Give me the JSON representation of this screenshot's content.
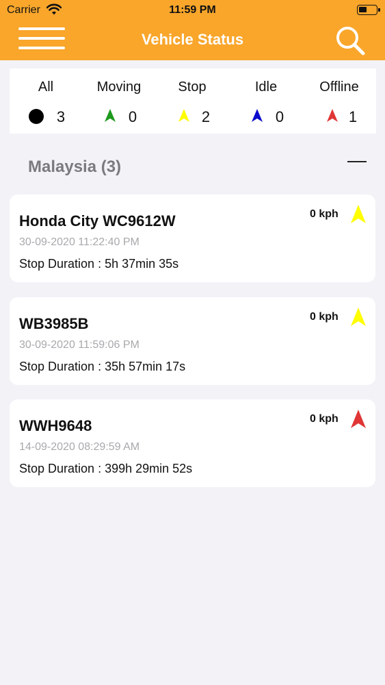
{
  "statusbar": {
    "carrier": "Carrier",
    "time": "11:59 PM"
  },
  "navbar": {
    "title": "Vehicle Status"
  },
  "colors": {
    "bar": "#f9a62b",
    "moving": "#1e9a1e",
    "stop": "#ffff00",
    "idle": "#0b0bcc",
    "offline": "#e03636"
  },
  "summary": [
    {
      "label": "All",
      "count": "3",
      "icon": "black-dot-icon"
    },
    {
      "label": "Moving",
      "count": "0",
      "icon": "green-arrow-icon"
    },
    {
      "label": "Stop",
      "count": "2",
      "icon": "yellow-arrow-icon"
    },
    {
      "label": "Idle",
      "count": "0",
      "icon": "blue-arrow-icon"
    },
    {
      "label": "Offline",
      "count": "1",
      "icon": "red-arrow-icon"
    }
  ],
  "group": {
    "title": "Malaysia (3)"
  },
  "vehicles": [
    {
      "name": "Honda City WC9612W",
      "timestamp": "30-09-2020 11:22:40 PM",
      "duration": "Stop Duration : 5h 37min 35s",
      "speed": "0 kph",
      "status_icon": "yellow-arrow-icon"
    },
    {
      "name": "WB3985B",
      "timestamp": "30-09-2020 11:59:06 PM",
      "duration": "Stop Duration : 35h 57min 17s",
      "speed": "0 kph",
      "status_icon": "yellow-arrow-icon"
    },
    {
      "name": "WWH9648",
      "timestamp": "14-09-2020 08:29:59 AM",
      "duration": "Stop Duration : 399h 29min 52s",
      "speed": "0 kph",
      "status_icon": "red-arrow-icon"
    }
  ]
}
